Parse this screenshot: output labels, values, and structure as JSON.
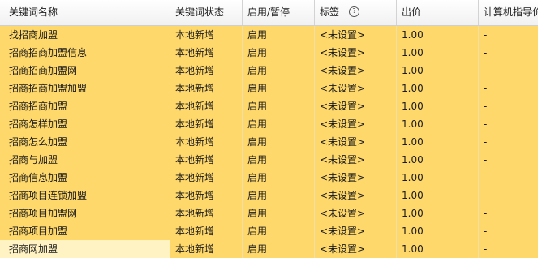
{
  "headers": [
    "关键词名称",
    "关键词状态",
    "启用/暂停",
    "标签",
    "出价",
    "计算机指导价"
  ],
  "help_glyph": "?",
  "colors": {
    "row_highlight": "#ffd86b",
    "last_row_first_cell": "#fff3c4"
  },
  "rows": [
    [
      "找招商加盟",
      "本地新增",
      "启用",
      "<未设置>",
      "1.00",
      "-"
    ],
    [
      "招商招商加盟信息",
      "本地新增",
      "启用",
      "<未设置>",
      "1.00",
      "-"
    ],
    [
      "招商招商加盟网",
      "本地新增",
      "启用",
      "<未设置>",
      "1.00",
      "-"
    ],
    [
      "招商招商加盟加盟",
      "本地新增",
      "启用",
      "<未设置>",
      "1.00",
      "-"
    ],
    [
      "招商招商加盟",
      "本地新增",
      "启用",
      "<未设置>",
      "1.00",
      "-"
    ],
    [
      "招商怎样加盟",
      "本地新增",
      "启用",
      "<未设置>",
      "1.00",
      "-"
    ],
    [
      "招商怎么加盟",
      "本地新增",
      "启用",
      "<未设置>",
      "1.00",
      "-"
    ],
    [
      "招商与加盟",
      "本地新增",
      "启用",
      "<未设置>",
      "1.00",
      "-"
    ],
    [
      "招商信息加盟",
      "本地新增",
      "启用",
      "<未设置>",
      "1.00",
      "-"
    ],
    [
      "招商项目连锁加盟",
      "本地新增",
      "启用",
      "<未设置>",
      "1.00",
      "-"
    ],
    [
      "招商项目加盟网",
      "本地新增",
      "启用",
      "<未设置>",
      "1.00",
      "-"
    ],
    [
      "招商项目加盟",
      "本地新增",
      "启用",
      "<未设置>",
      "1.00",
      "-"
    ],
    [
      "招商网加盟",
      "本地新增",
      "启用",
      "<未设置>",
      "1.00",
      "-"
    ]
  ]
}
